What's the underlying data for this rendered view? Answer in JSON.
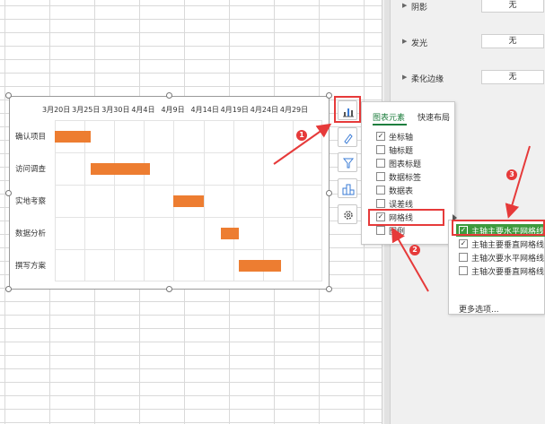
{
  "properties": [
    {
      "label": "阴影",
      "value": "无"
    },
    {
      "label": "发光",
      "value": "无"
    },
    {
      "label": "柔化边缘",
      "value": "无"
    }
  ],
  "chart_data": {
    "type": "bar",
    "subtype": "gantt",
    "x_tick_labels": [
      "3月20日",
      "3月25日",
      "3月30日",
      "4月4日",
      "4月9日",
      "4月14日",
      "4月19日",
      "4月24日",
      "4月29日"
    ],
    "categories": [
      "确认项目",
      "访问调查",
      "实地考察",
      "数据分析",
      "撰写方案"
    ],
    "start": [
      "3月20日",
      "3月26日",
      "4月9日",
      "4月17日",
      "4月20日"
    ],
    "end": [
      "3月26日",
      "4月5日",
      "4月14日",
      "4月20日",
      "4月27日"
    ],
    "bar_color": "#ed7d31",
    "grid": true
  },
  "popup": {
    "tabs": [
      "图表元素",
      "快速布局"
    ],
    "items": [
      {
        "label": "坐标轴",
        "checked": true
      },
      {
        "label": "轴标题",
        "checked": false
      },
      {
        "label": "图表标题",
        "checked": false
      },
      {
        "label": "数据标签",
        "checked": false
      },
      {
        "label": "数据表",
        "checked": false
      },
      {
        "label": "误差线",
        "checked": false
      },
      {
        "label": "网格线",
        "checked": true
      },
      {
        "label": "图例",
        "checked": false
      }
    ]
  },
  "submenu": {
    "items": [
      {
        "label": "主轴主要水平网格线",
        "checked": true
      },
      {
        "label": "主轴主要垂直网格线",
        "checked": true
      },
      {
        "label": "主轴次要水平网格线",
        "checked": false
      },
      {
        "label": "主轴次要垂直网格线",
        "checked": false
      }
    ],
    "more": "更多选项..."
  },
  "badges": [
    "1",
    "2",
    "3"
  ],
  "side_buttons": [
    "chart-elements-icon",
    "chart-style-icon",
    "chart-filter-icon",
    "chart-layout-icon",
    "chart-settings-icon"
  ],
  "colors": {
    "accent": "#1e7e3e",
    "highlight": "#3e9a3e",
    "annotation": "#e63a3a"
  }
}
